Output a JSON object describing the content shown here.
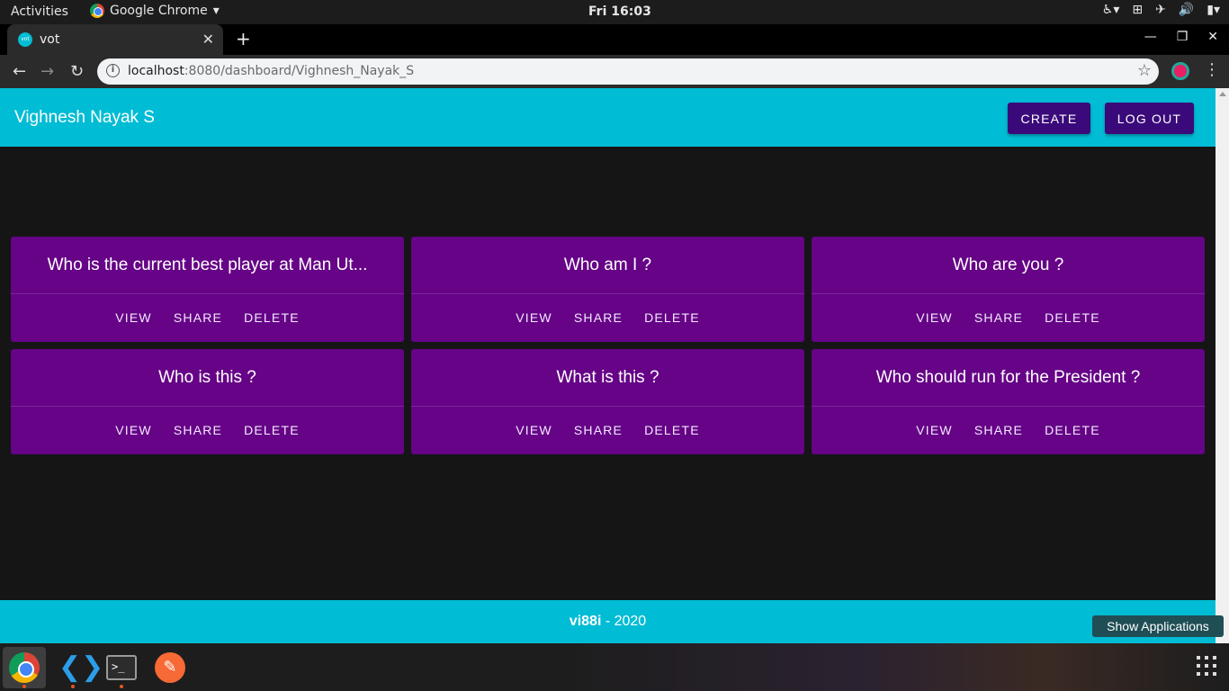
{
  "system": {
    "activities": "Activities",
    "app_name": "Google Chrome",
    "clock": "Fri 16:03"
  },
  "browser": {
    "tab_title": "vot",
    "favicon_text": "vot",
    "url_host": "localhost",
    "url_rest": ":8080/dashboard/Vighnesh_Nayak_S"
  },
  "app": {
    "user_name": "Vighnesh Nayak S",
    "create_label": "CREATE",
    "logout_label": "LOG OUT",
    "polls": [
      {
        "question": "Who is the current best player at Man Ut...",
        "view": "VIEW",
        "share": "SHARE",
        "delete": "DELETE"
      },
      {
        "question": "Who am I ?",
        "view": "VIEW",
        "share": "SHARE",
        "delete": "DELETE"
      },
      {
        "question": "Who are you ?",
        "view": "VIEW",
        "share": "SHARE",
        "delete": "DELETE"
      },
      {
        "question": "Who is this ?",
        "view": "VIEW",
        "share": "SHARE",
        "delete": "DELETE"
      },
      {
        "question": "What is this ?",
        "view": "VIEW",
        "share": "SHARE",
        "delete": "DELETE"
      },
      {
        "question": "Who should run for the President ?",
        "view": "VIEW",
        "share": "SHARE",
        "delete": "DELETE"
      }
    ],
    "footer_brand": "vi88i",
    "footer_year": " - 2020"
  },
  "dock": {
    "tooltip": "Show Applications"
  },
  "colors": {
    "appbar": "#00bcd4",
    "card": "#660387",
    "button": "#3a0a7a",
    "background": "#151515"
  }
}
